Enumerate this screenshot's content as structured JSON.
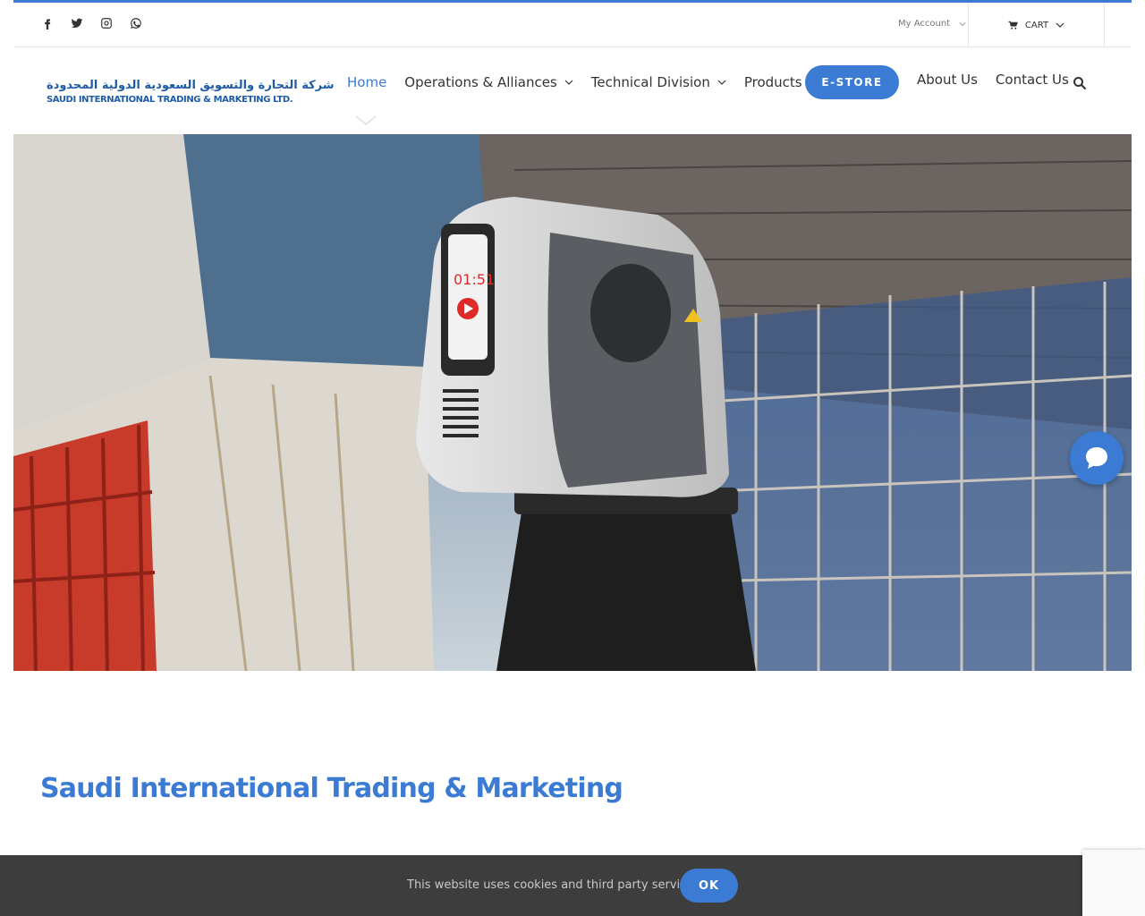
{
  "topbar": {
    "social": [
      "facebook-icon",
      "twitter-icon",
      "instagram-icon",
      "whatsapp-icon"
    ],
    "account_label": "My Account",
    "cart_label": "CART"
  },
  "logo": {
    "arabic": "شركة التجارة والتسويق السعودية الدولية المحدودة",
    "english": "SAUDI INTERNATIONAL TRADING & MARKETING LTD."
  },
  "nav": {
    "home": "Home",
    "operations": "Operations & Alliances",
    "technical": "Technical Division",
    "products": "Products",
    "estore": "E-STORE",
    "about": "About Us",
    "contact": "Contact Us"
  },
  "main": {
    "title": "Saudi International Trading & Marketing"
  },
  "cookie": {
    "text": "This website uses cookies and third party services.",
    "ok_label": "OK"
  },
  "colors": {
    "accent": "#3b7bd4",
    "cookie_bg": "#3d3d3d"
  }
}
